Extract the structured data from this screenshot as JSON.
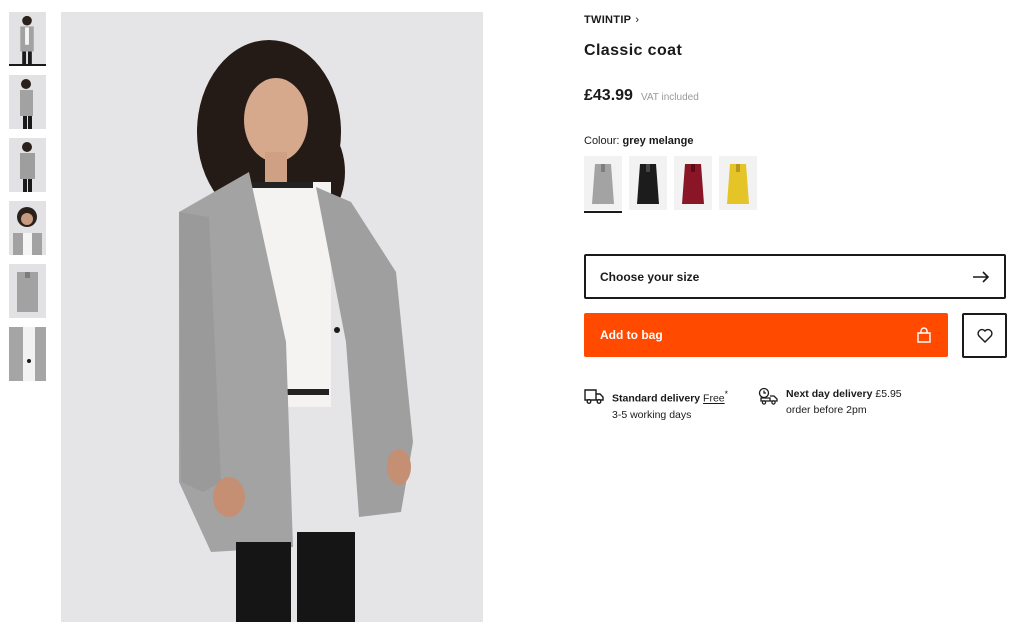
{
  "product": {
    "brand": "TWINTIP",
    "title": "Classic coat",
    "price": "£43.99",
    "vat_note": "VAT included"
  },
  "colour": {
    "label": "Colour:",
    "selected": "grey melange",
    "swatches": [
      {
        "name": "grey melange",
        "color": "#a3a3a3"
      },
      {
        "name": "black",
        "color": "#1c1c1c"
      },
      {
        "name": "burgundy",
        "color": "#8a1526"
      },
      {
        "name": "yellow",
        "color": "#e5c428"
      }
    ]
  },
  "size_select": {
    "label": "Choose your size",
    "icon": "arrow-right-icon"
  },
  "add_to_bag": {
    "label": "Add to bag",
    "icon": "bag-icon",
    "color": "#ff4a00"
  },
  "wishlist": {
    "icon": "heart-icon"
  },
  "delivery": {
    "standard": {
      "title": "Standard delivery",
      "price": "Free",
      "mark": "*",
      "detail": "3-5 working days",
      "icon": "truck-icon"
    },
    "next_day": {
      "title": "Next day delivery",
      "price": "£5.95",
      "detail": "order before 2pm",
      "icon": "fast-delivery-icon"
    }
  },
  "thumbnails": {
    "count": 6,
    "active_index": 0
  }
}
